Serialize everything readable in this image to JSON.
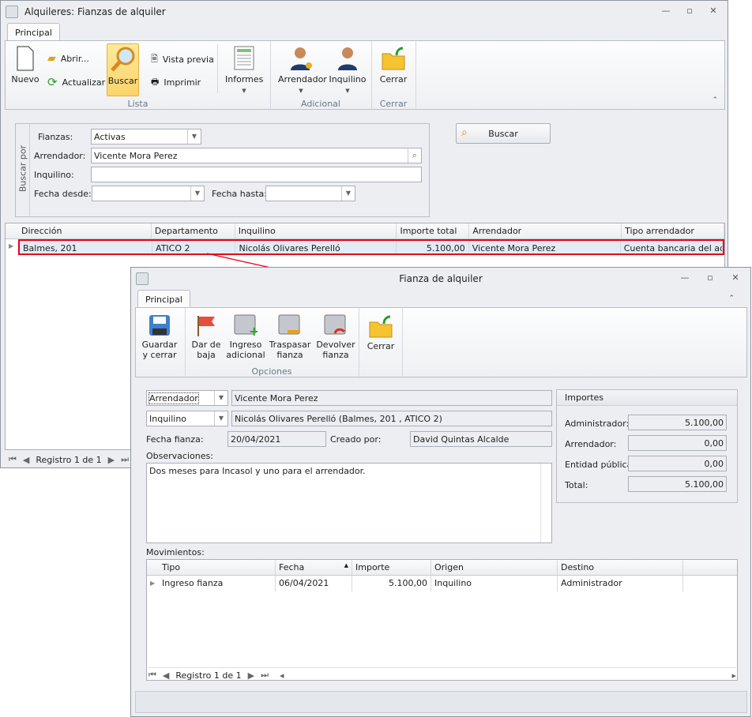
{
  "main": {
    "title": "Alquileres: Fianzas de alquiler",
    "tab": "Principal",
    "ribbon": {
      "nuevo": "Nuevo",
      "abrir": "Abrir...",
      "actualizar": "Actualizar",
      "buscar": "Buscar",
      "vista_previa": "Vista previa",
      "imprimir": "Imprimir",
      "informes": "Informes",
      "arrendador": "Arrendador",
      "inquilino": "Inquilino",
      "cerrar": "Cerrar",
      "groups": {
        "lista": "Lista",
        "adicional": "Adicional",
        "cerrar": "Cerrar"
      }
    },
    "search": {
      "group_label": "Buscar por",
      "fianzas_label": "Fianzas:",
      "fianzas_value": "Activas",
      "arrendador_label": "Arrendador:",
      "arrendador_value": "Vicente Mora Perez",
      "inquilino_label": "Inquilino:",
      "inquilino_value": "",
      "fecha_desde_label": "Fecha desde:",
      "fecha_hasta_label": "Fecha hasta:",
      "buscar_button": "Buscar"
    },
    "grid": {
      "columns": [
        "Dirección",
        "Departamento",
        "Inquilino",
        "Importe total",
        "Arrendador",
        "Tipo arrendador"
      ],
      "rows": [
        [
          "Balmes, 201",
          "ATICO 2",
          "Nicolás Olivares Perelló",
          "5.100,00",
          "Vicente Mora Perez",
          "Cuenta bancaria del admi"
        ]
      ]
    },
    "navigator": "Registro 1 de 1"
  },
  "detail": {
    "title": "Fianza de alquiler",
    "tab": "Principal",
    "ribbon": {
      "guardar": [
        "Guardar",
        "y cerrar"
      ],
      "baja": [
        "Dar de",
        "baja"
      ],
      "ingreso": [
        "Ingreso",
        "adicional"
      ],
      "traspasar": [
        "Traspasar",
        "fianza"
      ],
      "devolver": [
        "Devolver",
        "fianza"
      ],
      "cerrar": "Cerrar",
      "group": "Opciones"
    },
    "form": {
      "arrendador_type": "Arrendador",
      "arrendador_value": "Vicente Mora Perez",
      "inquilino_type": "Inquilino",
      "inquilino_value": "Nicolás Olivares Perelló (Balmes, 201 , ATICO 2)",
      "fecha_label": "Fecha fianza:",
      "fecha_value": "20/04/2021",
      "creado_label": "Creado por:",
      "creado_value": "David Quintas Alcalde",
      "observaciones_label": "Observaciones:",
      "observaciones": "Dos meses para Incasol y uno para el arrendador.",
      "movimientos_label": "Movimientos:"
    },
    "importes": {
      "title": "Importes",
      "administrador_label": "Administrador:",
      "administrador": "5.100,00",
      "arrendador_label": "Arrendador:",
      "arrendador": "0,00",
      "entidad_label": "Entidad pública:",
      "entidad": "0,00",
      "total_label": "Total:",
      "total": "5.100,00"
    },
    "grid": {
      "columns": [
        "Tipo",
        "Fecha",
        "Importe",
        "Origen",
        "Destino"
      ],
      "rows": [
        [
          "Ingreso fianza",
          "06/04/2021",
          "5.100,00",
          "Inquilino",
          "Administrador"
        ]
      ]
    },
    "navigator": "Registro 1 de 1"
  },
  "colors": {
    "selection": "#e8001c",
    "accent": "#fbd46a"
  }
}
